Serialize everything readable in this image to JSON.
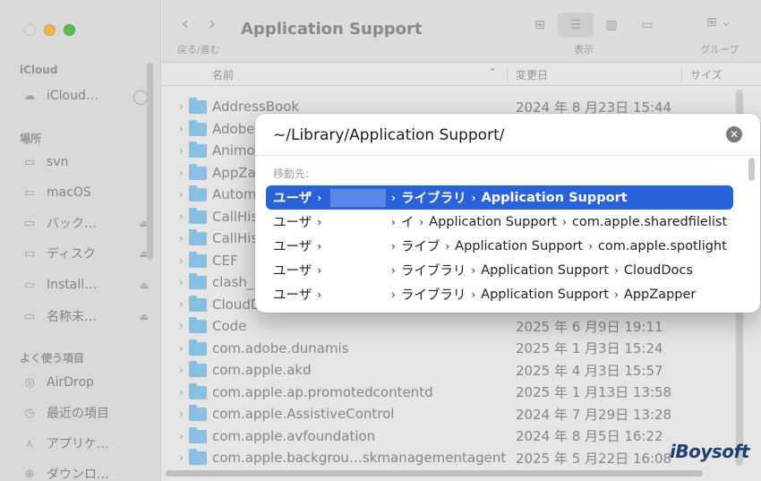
{
  "sidebar": {
    "sections": [
      {
        "label": "iCloud"
      },
      {
        "label": "場所"
      },
      {
        "label": "よく使う項目"
      }
    ],
    "icloud_item": "iCloud…",
    "places": [
      {
        "label": "svn",
        "icon": "drive-icon"
      },
      {
        "label": "macOS",
        "icon": "drive-icon"
      },
      {
        "label": "バック…",
        "icon": "drive-icon"
      },
      {
        "label": "ディスク",
        "icon": "drive-icon"
      },
      {
        "label": "Install…",
        "icon": "drive-icon"
      },
      {
        "label": "名称未…",
        "icon": "drive-icon"
      }
    ],
    "favorites": [
      {
        "label": "AirDrop",
        "icon": "airdrop-icon"
      },
      {
        "label": "最近の項目",
        "icon": "clock-icon"
      },
      {
        "label": "アプリケ…",
        "icon": "applications-icon"
      },
      {
        "label": "ダウンロ…",
        "icon": "download-icon"
      }
    ]
  },
  "toolbar": {
    "title": "Application Support",
    "nav_label": "戻る/進む",
    "view_label": "表示",
    "group_label": "グループ"
  },
  "list": {
    "headers": {
      "name": "名前",
      "date": "変更日",
      "size": "サイズ"
    },
    "rows": [
      {
        "name": "AddressBook",
        "date": "2024 年 8 月23日 15:44"
      },
      {
        "name": "Adobe",
        "date": ""
      },
      {
        "name": "Animo",
        "date": ""
      },
      {
        "name": "AppZa",
        "date": ""
      },
      {
        "name": "Autom",
        "date": ""
      },
      {
        "name": "CallHis",
        "date": ""
      },
      {
        "name": "CallHis",
        "date": ""
      },
      {
        "name": "CEF",
        "date": ""
      },
      {
        "name": "clash_",
        "date": ""
      },
      {
        "name": "CloudD",
        "date": ""
      },
      {
        "name": "Code",
        "date": "2025 年 6 月9日 19:11"
      },
      {
        "name": "com.adobe.dunamis",
        "date": "2025 年 1 月3日 15:24"
      },
      {
        "name": "com.apple.akd",
        "date": "2025 年 4 月3日 15:57"
      },
      {
        "name": "com.apple.ap.promotedcontentd",
        "date": "2025 年 1 月13日 13:58"
      },
      {
        "name": "com.apple.AssistiveControl",
        "date": "2024 年 7 月29日 13:28"
      },
      {
        "name": "com.apple.avfoundation",
        "date": "2024 年 8 月5日 16:22"
      },
      {
        "name": "com.apple.backgrou…skmanagementagent",
        "date": "2025 年 5 月22日 16:08"
      }
    ]
  },
  "dialog": {
    "path_value": "~/Library/Application Support/",
    "goto_label": "移動先:",
    "suggestions": [
      {
        "segments": [
          "ユーザ",
          "",
          "ライブラリ",
          "Application Support"
        ],
        "selected": true
      },
      {
        "segments": [
          "ユーザ",
          "",
          "イ",
          "Application Support",
          "com.apple.sharedfilelist"
        ],
        "selected": false
      },
      {
        "segments": [
          "ユーザ",
          "",
          "ライブ",
          "Application Support",
          "com.apple.spotlight"
        ],
        "selected": false
      },
      {
        "segments": [
          "ユーザ",
          "",
          "ライブラリ",
          "Application Support",
          "CloudDocs"
        ],
        "selected": false
      },
      {
        "segments": [
          "ユーザ",
          "",
          "ライブラリ",
          "Application Support",
          "AppZapper"
        ],
        "selected": false
      }
    ]
  },
  "watermark": "iBoysoft",
  "colors": {
    "selection": "#2a62d9",
    "folder": "#8ec7ea",
    "watermark": "#1f3e73"
  }
}
